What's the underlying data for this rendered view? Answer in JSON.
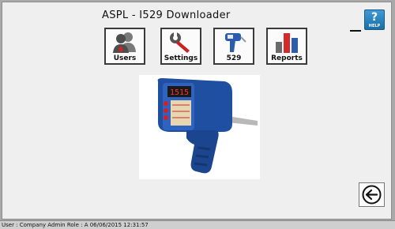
{
  "app": {
    "title": "ASPL - I529 Downloader"
  },
  "help": {
    "icon": "help-icon",
    "symbol": "?",
    "label": "HELP"
  },
  "toolbar": {
    "users": {
      "label": "Users",
      "icon": "users-icon"
    },
    "settings": {
      "label": "Settings",
      "icon": "wrench-icon"
    },
    "device": {
      "label": "529",
      "icon": "device-icon"
    },
    "reports": {
      "label": "Reports",
      "icon": "bar-chart-icon"
    }
  },
  "device_image": {
    "display_reading": "1515",
    "body_color": "#1f4fa0"
  },
  "back": {
    "icon": "back-arrow-icon"
  },
  "status": {
    "text": "User : Company Admin Role : A 06/06/2015 12:31:57"
  },
  "colors": {
    "accent": "#1b6ea8",
    "window_bg": "#efefef",
    "status_bg": "#cfcfcf"
  }
}
